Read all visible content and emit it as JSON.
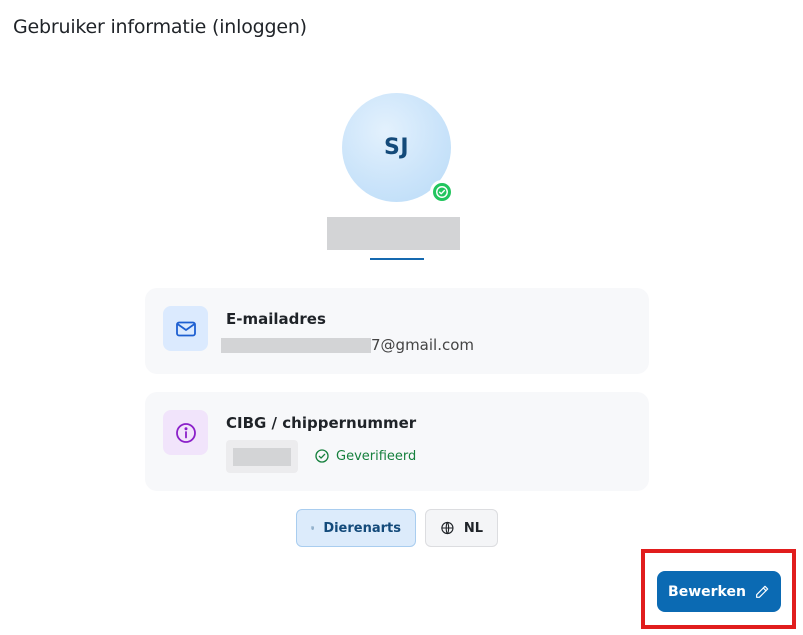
{
  "page": {
    "title": "Gebruiker informatie (inloggen)"
  },
  "profile": {
    "initials": "SJ",
    "status_color": "#22c55e",
    "name_visible": ""
  },
  "email_card": {
    "label": "E-mailadres",
    "value_suffix": "7@gmail.com",
    "icon": "mail-icon"
  },
  "cibg_card": {
    "label": "CIBG / chippernummer",
    "status": "Geverifieerd",
    "icon": "info-icon"
  },
  "badges": {
    "role": {
      "label": "Dierenarts",
      "icon": "building-icon"
    },
    "language": {
      "label": "NL",
      "icon": "globe-icon"
    }
  },
  "actions": {
    "edit_label": "Bewerken",
    "edit_icon": "pencil-icon"
  },
  "colors": {
    "primary": "#0b6ab3",
    "verified": "#15803d",
    "highlight": "#e11d1d"
  }
}
